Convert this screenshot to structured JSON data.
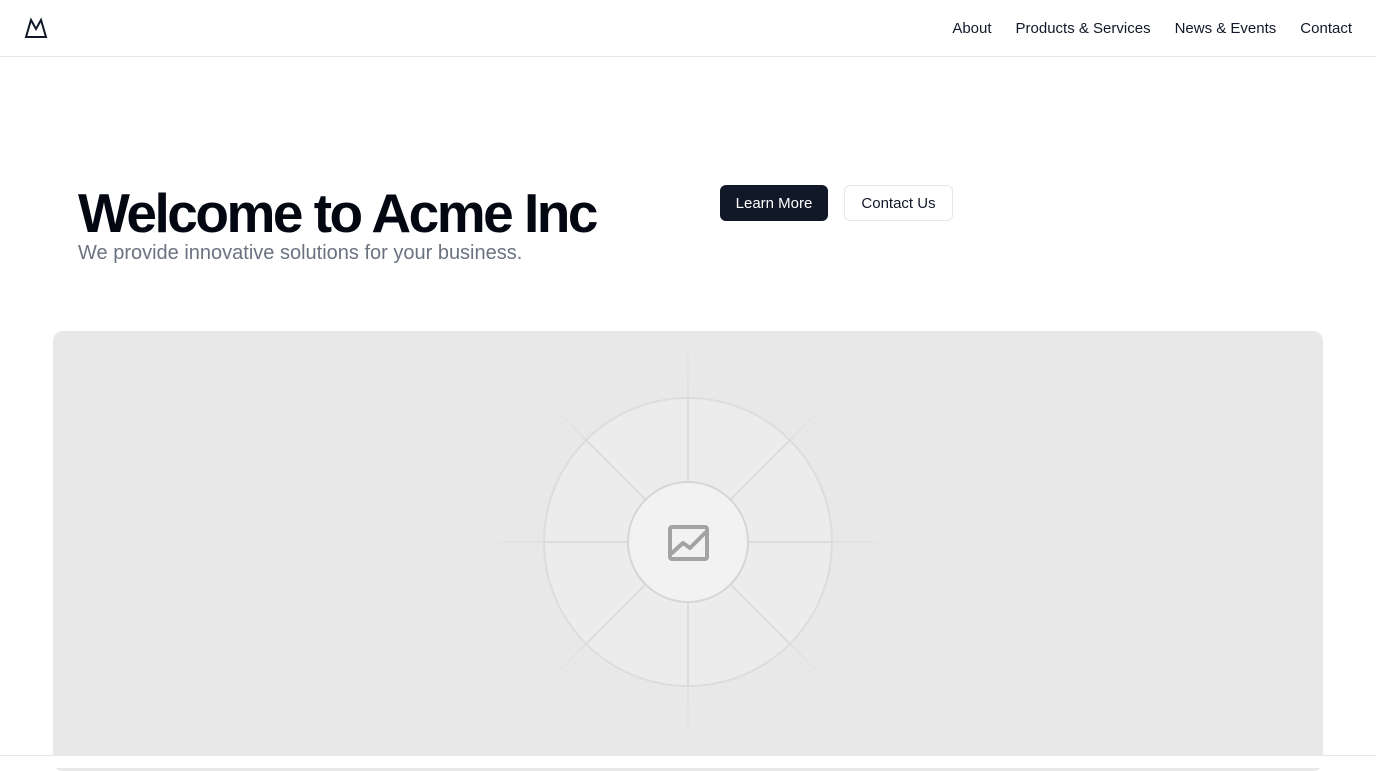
{
  "header": {
    "logo_icon": "mountain-icon",
    "nav": [
      {
        "label": "About"
      },
      {
        "label": "Products & Services"
      },
      {
        "label": "News & Events"
      },
      {
        "label": "Contact"
      }
    ]
  },
  "hero": {
    "title": "Welcome to Acme Inc",
    "subtitle": "We provide innovative solutions for your business.",
    "primary_button": "Learn More",
    "secondary_button": "Contact Us"
  },
  "placeholder": {
    "icon": "image-icon"
  },
  "colors": {
    "primary_button_bg": "#111827",
    "subtitle_text": "#6b7280",
    "placeholder_bg": "#e8e8e8"
  }
}
